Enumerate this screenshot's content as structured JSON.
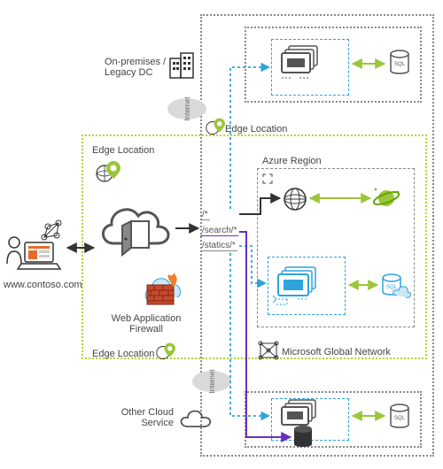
{
  "labels": {
    "on_prem": "On-premises / Legacy DC",
    "edge_loc_top": "Edge Location",
    "edge_loc_left": "Edge Location",
    "edge_loc_bottom": "Edge Location",
    "azure_region": "Azure Region",
    "waf": "Web Application Firewall",
    "site_url": "www.contoso.com",
    "msgn": "Microsoft Global Network",
    "other_cloud": "Other Cloud Service",
    "internet_top": "Internet",
    "internet_bottom": "Internet"
  },
  "routes": {
    "root": "/*",
    "search": "/search/*",
    "statics": "/statics/*"
  },
  "icons": {
    "user_devices": "user-laptop-network",
    "building": "datacenter-building",
    "cloud_door": "cloud-open-door",
    "firewall": "firewall-brick-flame",
    "location_pin": "globe-pin",
    "globe": "globe",
    "planet": "planet-ring",
    "vm_cluster_blue": "vm-cluster-blue",
    "vm_cluster_gray": "vm-cluster-gray",
    "sql_db_blue": "sql-database-blue",
    "sql_db_gray": "sql-database-gray",
    "sql_db_cloud": "sql-database-cloud",
    "storage_cylinder": "storage-cylinder",
    "network_mesh": "network-mesh",
    "cloud": "cloud",
    "expand": "expand-icon"
  },
  "colors": {
    "blue": "#2ea3dd",
    "green": "#9cc53b",
    "darkgreen": "#5fa800",
    "gray": "#888888",
    "purple": "#6a2fbf",
    "black": "#333333",
    "orange": "#e66b2c",
    "brick": "#c8482c"
  }
}
